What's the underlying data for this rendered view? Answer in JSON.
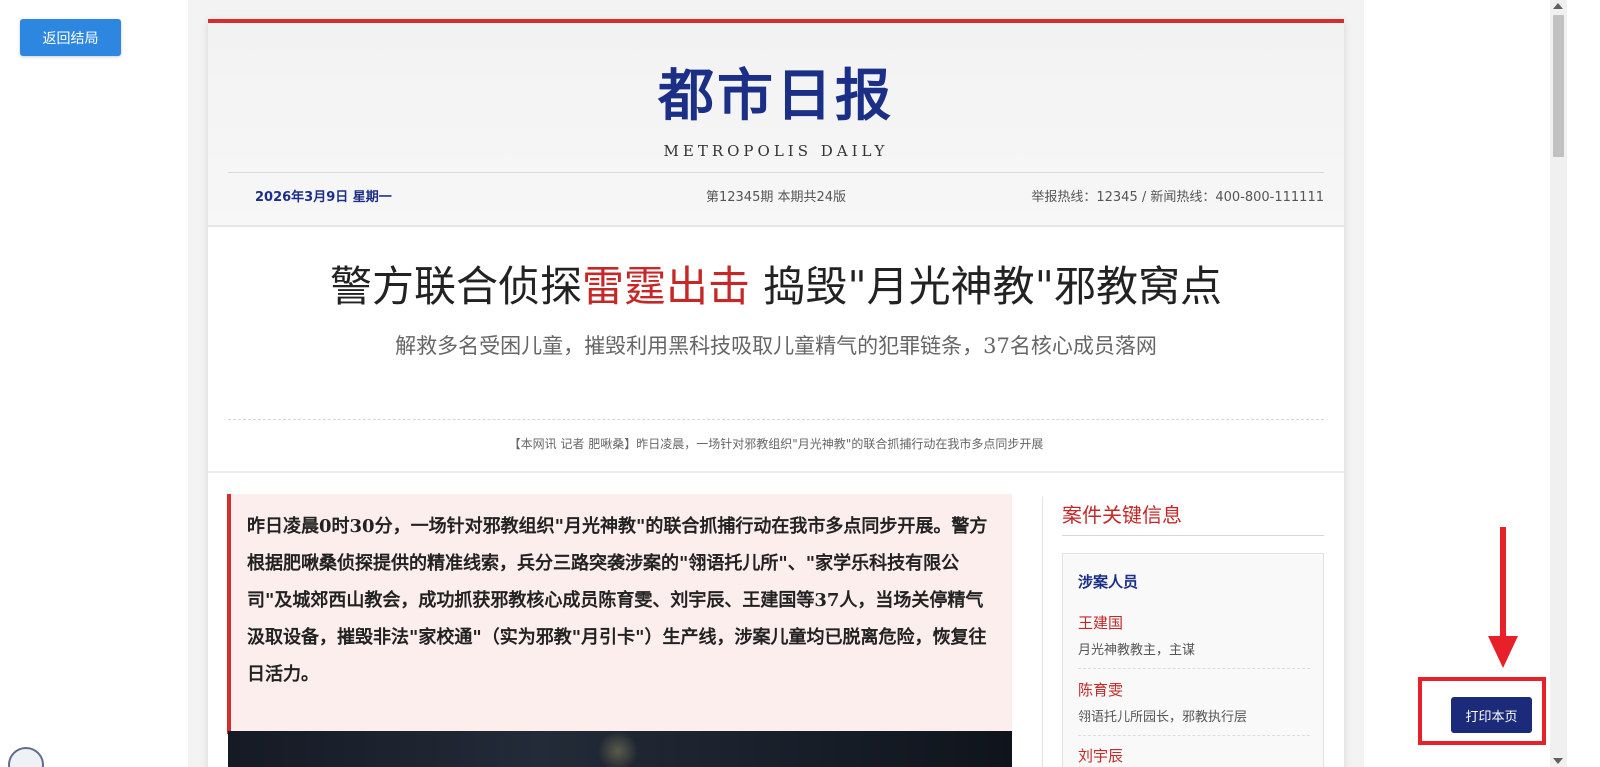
{
  "nav": {
    "back_label": "返回结局"
  },
  "masthead": {
    "title": "都市日报",
    "subtitle": "METROPOLIS DAILY",
    "date": "2026年3月9日 星期一",
    "issue": "第12345期 本期共24版",
    "hotline": "举报热线：12345 / 新闻热线：400-800-111111"
  },
  "article": {
    "headline_part1": "警方联合侦探",
    "headline_red": "雷霆出击",
    "headline_part2": " 捣毁\"月光神教\"邪教窝点",
    "deck": "解救多名受困儿童，摧毁利用黑科技吸取儿童精气的犯罪链条，37名核心成员落网",
    "lead_line": "【本网讯 记者 肥啾桑】昨日凌晨，一场针对邪教组织\"月光神教\"的联合抓捕行动在我市多点同步开展",
    "intro": "昨日凌晨0时30分，一场针对邪教组织\"月光神教\"的联合抓捕行动在我市多点同步开展。警方根据肥啾桑侦探提供的精准线索，兵分三路突袭涉案的\"翎语托儿所\"、\"家学乐科技有限公司\"及城郊西山教会，成功抓获邪教核心成员陈育雯、刘宇辰、王建国等37人，当场关停精气汲取设备，摧毁非法\"家校通\"（实为邪教\"月引卡\"）生产线，涉案儿童均已脱离危险，恢复往日活力。"
  },
  "sidebar": {
    "title": "案件关键信息",
    "section_title": "涉案人员",
    "people": [
      {
        "name": "王建国",
        "role": "月光神教教主，主谋"
      },
      {
        "name": "陈育雯",
        "role": "翎语托儿所园长，邪教执行层"
      },
      {
        "name": "刘宇辰",
        "role": ""
      }
    ]
  },
  "actions": {
    "print_label": "打印本页"
  },
  "colors": {
    "accent_red": "#d32f2f",
    "brand_navy": "#1c2f87",
    "button_blue": "#2d86e0",
    "annotation_red": "#e8202a"
  }
}
